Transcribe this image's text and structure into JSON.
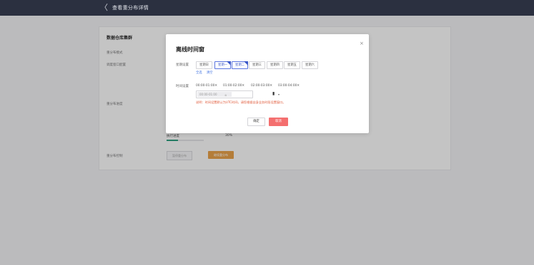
{
  "header": {
    "back_glyph": "〈",
    "title": "查看重分布详情"
  },
  "card": {
    "section_title": "数据仓库集群",
    "labels": [
      "重分布模式",
      "调度窗口配置",
      "重分布进度",
      "重分布控制"
    ],
    "progress_label": "执行进度",
    "progress_value": "30%",
    "progress_fraction": 0.3,
    "buttons": {
      "disabled": "暂停重分布",
      "primary": "继续重分布"
    }
  },
  "modal": {
    "title": "离线时间窗",
    "close_glyph": "×",
    "week_label": "星期设置",
    "weekdays": [
      {
        "label": "星期日",
        "selected": false
      },
      {
        "label": "星期一",
        "selected": true
      },
      {
        "label": "星期二",
        "selected": true
      },
      {
        "label": "星期三",
        "selected": false
      },
      {
        "label": "星期四",
        "selected": false
      },
      {
        "label": "星期五",
        "selected": false
      },
      {
        "label": "星期六",
        "selected": false
      }
    ],
    "select_all": "全选",
    "clear": "清空",
    "time_label": "时间设置",
    "time_slots": [
      "00:00-01:00✕",
      "01:00-02:00✕",
      "02:00-03:00✕",
      "03:00-04:00✕"
    ],
    "time_select": {
      "value": "00:00-01:00",
      "clear_glyph": "⊗",
      "arrow": "▾"
    },
    "note": "说明：时间设置默认为UTC时间，请您根据自身业务时段设置窗口。",
    "cancel": "确定",
    "confirm": "取消"
  },
  "colors": {
    "topbar": "#2b3040",
    "accent": "#3a57c8",
    "danger": "#f46f6f",
    "orange": "#e7a04a",
    "progress": "#2f9e7f"
  }
}
